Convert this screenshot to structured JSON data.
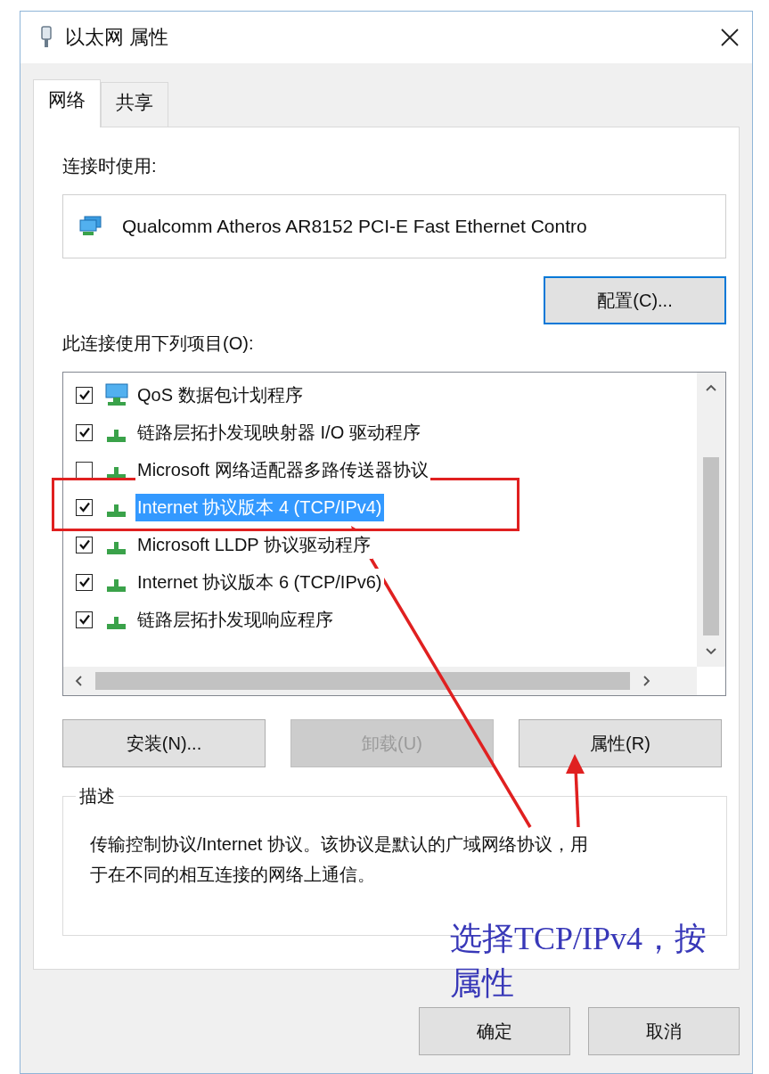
{
  "window": {
    "title": "以太网 属性"
  },
  "tabs": [
    {
      "label": "网络",
      "selected": true
    },
    {
      "label": "共享",
      "selected": false
    }
  ],
  "connect_using": {
    "label": "连接时使用:",
    "adapter": "Qualcomm Atheros AR8152 PCI-E Fast Ethernet Contro"
  },
  "configure_button": {
    "label": "配置(C)...",
    "focused": true
  },
  "items_label": "此连接使用下列项目(O):",
  "items": [
    {
      "kind": "qos",
      "label": "QoS 数据包计划程序",
      "checked": true,
      "selected": false
    },
    {
      "kind": "protocol",
      "label": "链路层拓扑发现映射器 I/O 驱动程序",
      "checked": true,
      "selected": false
    },
    {
      "kind": "protocol",
      "label": "Microsoft 网络适配器多路传送器协议",
      "checked": false,
      "selected": false
    },
    {
      "kind": "protocol",
      "label": "Internet 协议版本 4 (TCP/IPv4)",
      "checked": true,
      "selected": true
    },
    {
      "kind": "protocol",
      "label": "Microsoft LLDP 协议驱动程序",
      "checked": true,
      "selected": false
    },
    {
      "kind": "protocol",
      "label": "Internet 协议版本 6 (TCP/IPv6)",
      "checked": true,
      "selected": false
    },
    {
      "kind": "protocol",
      "label": "链路层拓扑发现响应程序",
      "checked": true,
      "selected": false
    }
  ],
  "item_buttons": [
    {
      "label": "安装(N)...",
      "disabled": false
    },
    {
      "label": "卸载(U)",
      "disabled": true
    },
    {
      "label": "属性(R)",
      "disabled": false
    }
  ],
  "description": {
    "title": "描述",
    "text": "传输控制协议/Internet 协议。该协议是默认的广域网络协议，用于在不同的相互连接的网络上通信。"
  },
  "dialog_buttons": [
    {
      "label": "确定"
    },
    {
      "label": "取消"
    }
  ],
  "annotation": {
    "note": "选择TCP/IPv4，按属性"
  }
}
